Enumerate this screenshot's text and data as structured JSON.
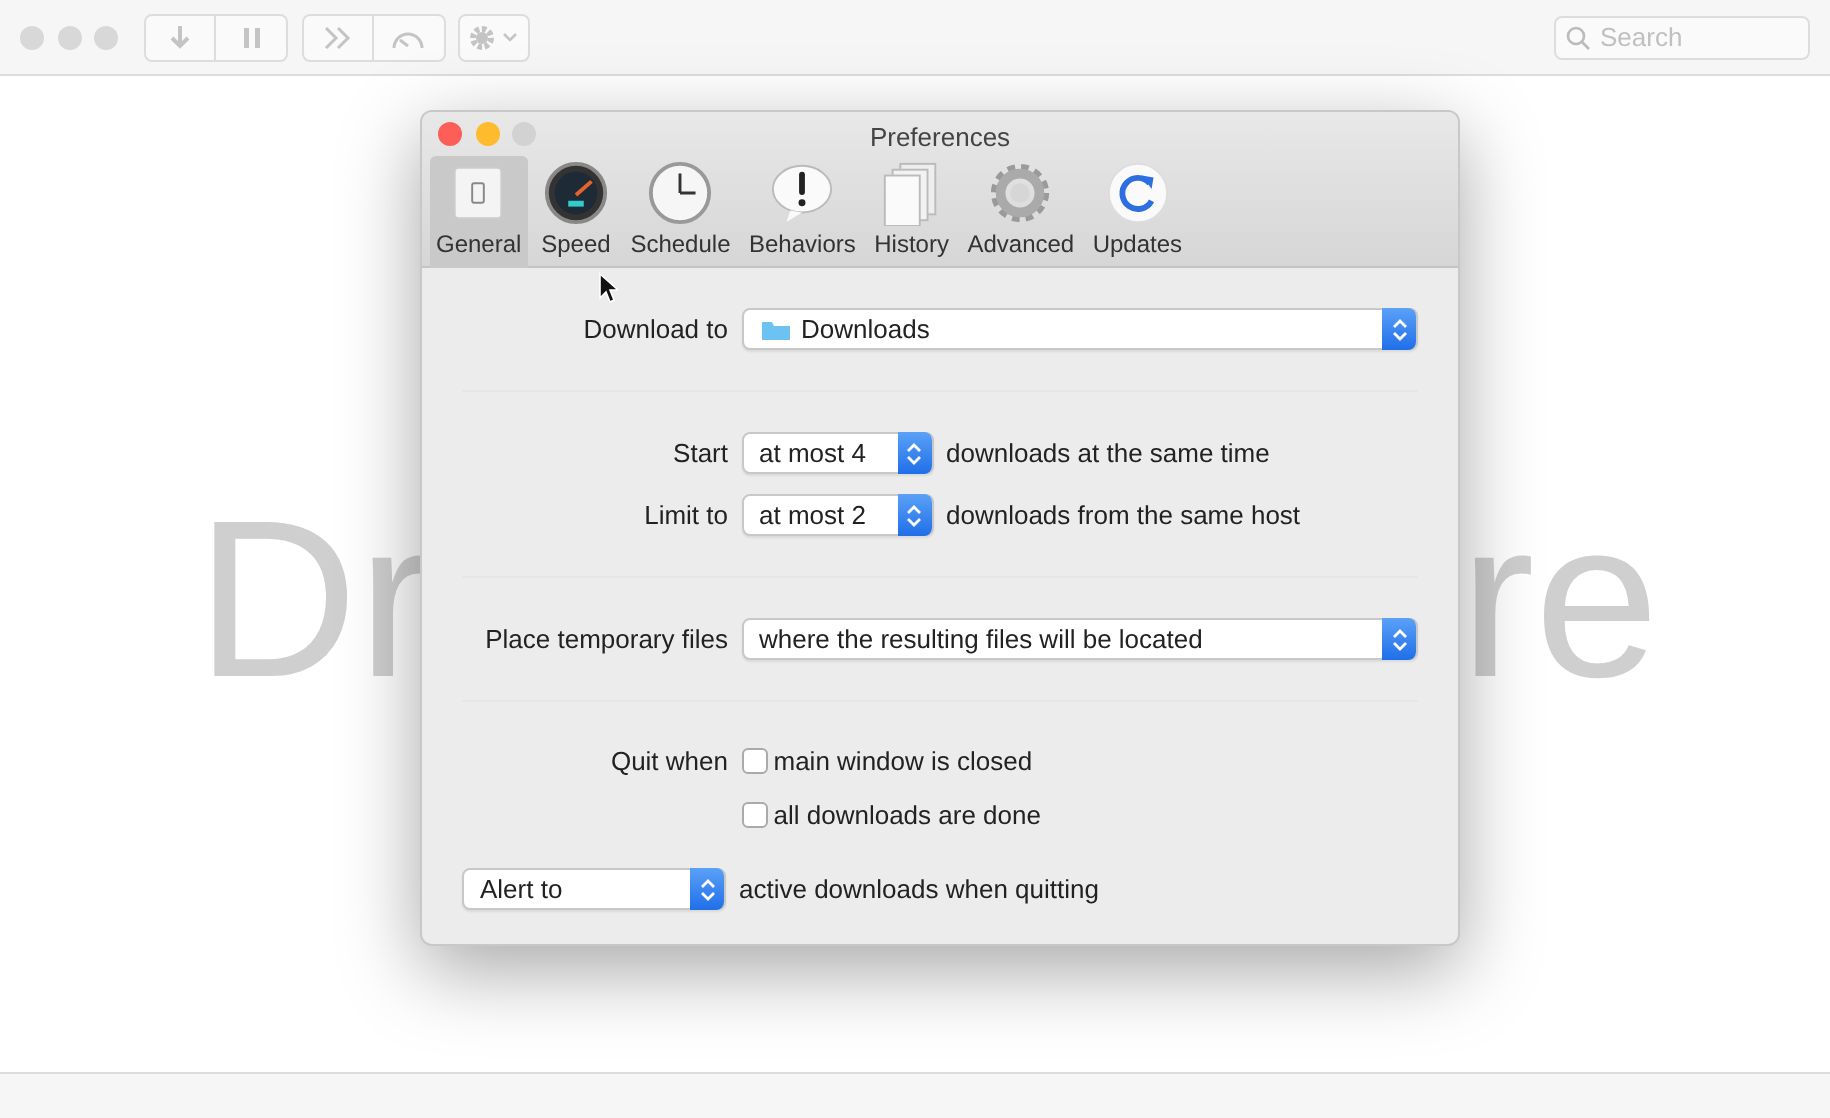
{
  "window": {
    "search": {
      "placeholder": "Search"
    },
    "background_text": [
      "Dr",
      "re"
    ]
  },
  "dialog": {
    "title": "Preferences",
    "traffic_lights": [
      {
        "color": "#fd5f57"
      },
      {
        "color": "#febb2e"
      },
      {
        "color": "#d2d2d2"
      }
    ],
    "tabs": [
      {
        "label": "General",
        "kind": "switch",
        "selected": true
      },
      {
        "label": "Speed",
        "kind": "gauge",
        "selected": false
      },
      {
        "label": "Schedule",
        "kind": "clock",
        "selected": false
      },
      {
        "label": "Behaviors",
        "kind": "alert",
        "selected": false
      },
      {
        "label": "History",
        "kind": "pages",
        "selected": false
      },
      {
        "label": "Advanced",
        "kind": "gear",
        "selected": false
      },
      {
        "label": "Updates",
        "kind": "refresh",
        "selected": false
      }
    ],
    "download_to": {
      "label": "Download to",
      "value": "Downloads"
    },
    "start": {
      "label": "Start",
      "value": "at most 4",
      "suffix": "downloads at the same time"
    },
    "limit": {
      "label": "Limit to",
      "value": "at most 2",
      "suffix": "downloads from the same host"
    },
    "temporary": {
      "label": "Place temporary files",
      "value": "where the resulting files will be located"
    },
    "quit": {
      "label": "Quit when",
      "options": [
        {
          "label": "main window is closed",
          "checked": false
        },
        {
          "label": "all downloads are done",
          "checked": false
        }
      ]
    },
    "alert": {
      "value": "Alert to",
      "suffix": "active downloads when quitting"
    }
  }
}
